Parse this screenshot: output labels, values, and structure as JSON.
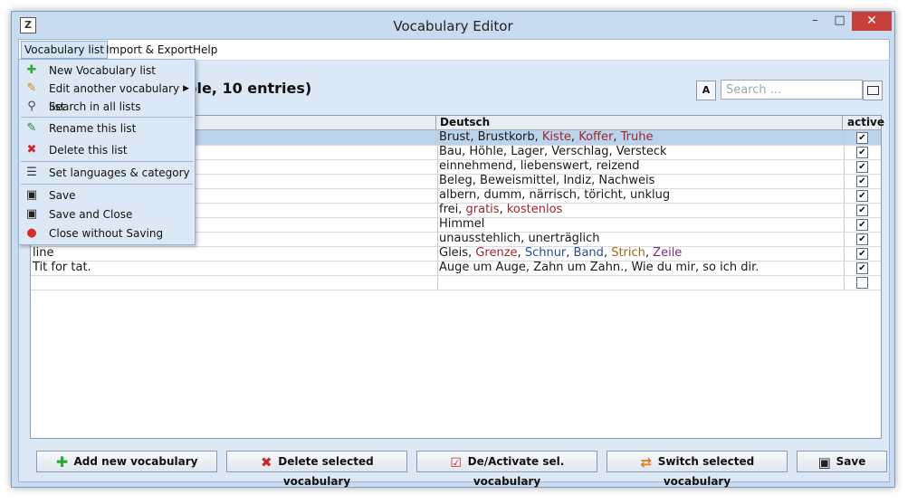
{
  "window": {
    "title": "Vocabulary Editor",
    "minimize": "–",
    "maximize": "□",
    "close": "✕",
    "app_icon": "Z"
  },
  "menubar": {
    "items": [
      "Vocabulary list",
      "Import & Export",
      "Help"
    ]
  },
  "heading": "ple, 10 entries)",
  "font_button": "A",
  "search": {
    "placeholder": "Search ..."
  },
  "table": {
    "columns": [
      "",
      "Deutsch",
      "active"
    ],
    "rows": [
      {
        "source": "",
        "target_parts": [
          {
            "text": "Brust",
            "color": "#1a1a1a"
          },
          {
            "text": ", ",
            "color": "#1a1a1a"
          },
          {
            "text": "Brustkorb",
            "color": "#1a1a1a"
          },
          {
            "text": ", ",
            "color": "#1a1a1a"
          },
          {
            "text": "Kiste",
            "color": "#a0262b"
          },
          {
            "text": ", ",
            "color": "#1a1a1a"
          },
          {
            "text": "Koffer",
            "color": "#a0262b"
          },
          {
            "text": ", ",
            "color": "#1a1a1a"
          },
          {
            "text": "Truhe",
            "color": "#a0262b"
          }
        ],
        "active": true,
        "selected": true
      },
      {
        "source": "",
        "target_parts": [
          {
            "text": "Bau, Höhle, Lager, Verschlag, Versteck",
            "color": "#1a1a1a"
          }
        ],
        "active": true
      },
      {
        "source": "",
        "target_parts": [
          {
            "text": "einnehmend, liebenswert, reizend",
            "color": "#1a1a1a"
          }
        ],
        "active": true
      },
      {
        "source": "",
        "target_parts": [
          {
            "text": "Beleg, Beweismittel, Indiz, Nachweis",
            "color": "#1a1a1a"
          }
        ],
        "active": true
      },
      {
        "source": "",
        "target_parts": [
          {
            "text": "albern, dumm, närrisch, töricht, unklug",
            "color": "#1a1a1a"
          }
        ],
        "active": true
      },
      {
        "source": "",
        "target_parts": [
          {
            "text": "frei",
            "color": "#1a1a1a"
          },
          {
            "text": ", ",
            "color": "#1a1a1a"
          },
          {
            "text": "gratis",
            "color": "#a0262b"
          },
          {
            "text": ", ",
            "color": "#1a1a1a"
          },
          {
            "text": "kostenlos",
            "color": "#a0262b"
          }
        ],
        "active": true
      },
      {
        "source": "",
        "target_parts": [
          {
            "text": "Himmel",
            "color": "#1a1a1a"
          }
        ],
        "active": true
      },
      {
        "source": "",
        "target_parts": [
          {
            "text": "unausstehlich, unerträglich",
            "color": "#1a1a1a"
          }
        ],
        "active": true
      },
      {
        "source": "line",
        "target_parts": [
          {
            "text": "Gleis",
            "color": "#1a1a1a"
          },
          {
            "text": ", ",
            "color": "#1a1a1a"
          },
          {
            "text": "Grenze",
            "color": "#a0262b"
          },
          {
            "text": ", ",
            "color": "#1a1a1a"
          },
          {
            "text": "Schnur",
            "color": "#2a4a9a"
          },
          {
            "text": ", ",
            "color": "#1a1a1a"
          },
          {
            "text": "Band",
            "color": "#2a4a9a"
          },
          {
            "text": ", ",
            "color": "#1a1a1a"
          },
          {
            "text": "Strich",
            "color": "#a06a10"
          },
          {
            "text": ", ",
            "color": "#1a1a1a"
          },
          {
            "text": "Zeile",
            "color": "#7a2a8a"
          }
        ],
        "active": true
      },
      {
        "source": "Tit for tat.",
        "target_parts": [
          {
            "text": "Auge um Auge, Zahn um Zahn., Wie du mir, so ich dir.",
            "color": "#1a1a1a"
          }
        ],
        "active": true
      },
      {
        "source": "",
        "target_parts": [],
        "active": false
      }
    ]
  },
  "buttons": {
    "add": "Add new vocabulary",
    "delete": "Delete selected vocabulary",
    "toggle": "De/Activate sel. vocabulary",
    "switch": "Switch selected vocabulary",
    "save": "Save"
  },
  "dropdown": {
    "items": [
      {
        "label": "New Vocabulary list",
        "icon": "plus-icon",
        "glyph": "✚",
        "color": "#2ea836"
      },
      {
        "label": "Edit another vocabulary list",
        "icon": "pencil-icon",
        "glyph": "✎",
        "color": "#c98a1c",
        "submenu": true
      },
      {
        "label": "Search in all lists",
        "icon": "magnifier-icon",
        "glyph": "⚲",
        "color": "#444"
      },
      {
        "label": "Rename this list",
        "icon": "rename-icon",
        "glyph": "✎",
        "color": "#2e7d32"
      },
      {
        "label": "Delete this list",
        "icon": "delete-icon",
        "glyph": "✖",
        "color": "#c62828"
      },
      {
        "label": "Set languages & category",
        "icon": "list-settings-icon",
        "glyph": "☰",
        "color": "#333"
      },
      {
        "label": "Save",
        "icon": "floppy-icon",
        "glyph": "▣",
        "color": "#222"
      },
      {
        "label": "Save and Close",
        "icon": "floppy-close-icon",
        "glyph": "▣",
        "color": "#222"
      },
      {
        "label": "Close without Saving",
        "icon": "no-save-icon",
        "glyph": "●",
        "color": "#d32f2f"
      }
    ],
    "submenu_arrow": "▶"
  }
}
